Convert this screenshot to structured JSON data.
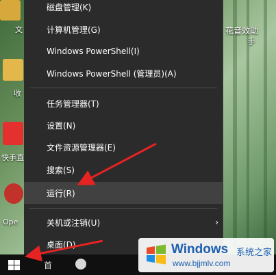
{
  "desktop": {
    "right_icon_label_line1": "花音效助",
    "right_icon_label_line2": "手",
    "left_labels": [
      "文",
      "收",
      "快手直",
      "Ope"
    ]
  },
  "menu": {
    "items": [
      {
        "label": "磁盘管理(K)"
      },
      {
        "label": "计算机管理(G)"
      },
      {
        "label": "Windows PowerShell(I)"
      },
      {
        "label": "Windows PowerShell (管理员)(A)"
      },
      {
        "label": "任务管理器(T)"
      },
      {
        "label": "设置(N)"
      },
      {
        "label": "文件资源管理器(E)"
      },
      {
        "label": "搜索(S)"
      },
      {
        "label": "运行(R)"
      },
      {
        "label": "关机或注销(U)"
      },
      {
        "label": "桌面(D)"
      }
    ],
    "submenu_chevron": "›",
    "highlighted_item": "运行(R)"
  },
  "taskbar": {
    "text": "首"
  },
  "watermark": {
    "title": "Windows",
    "subtitle": "系统之家",
    "url": "www.bjjmlv.com"
  },
  "colors": {
    "menu_bg": "#2b2b2b",
    "menu_hover": "#414141",
    "arrow": "#e52323",
    "watermark_text": "#1d5fb0"
  }
}
